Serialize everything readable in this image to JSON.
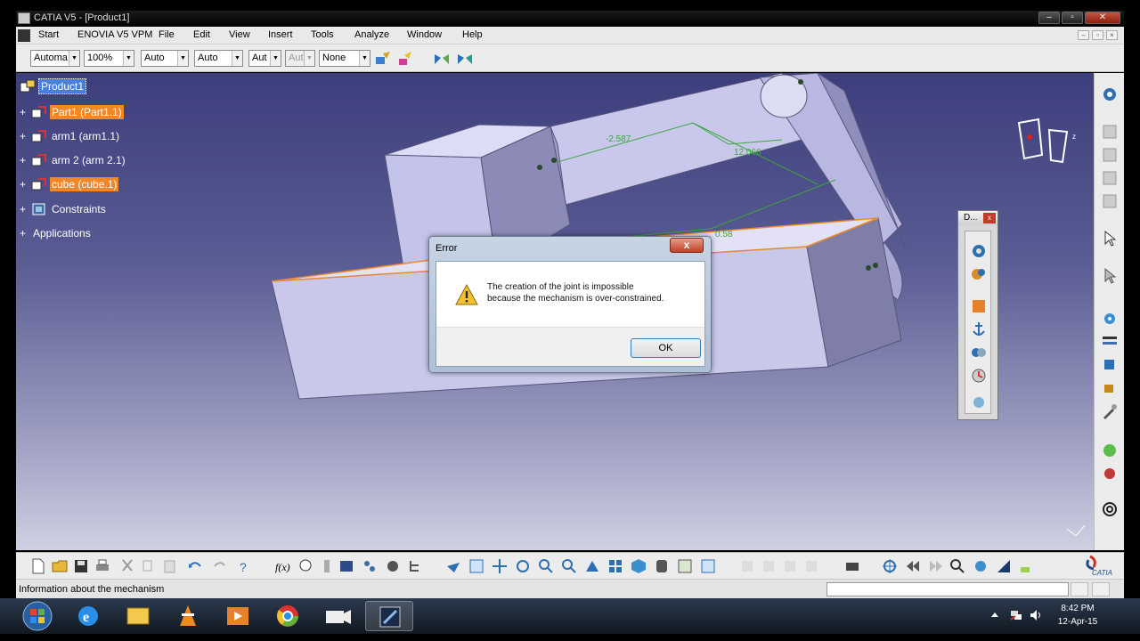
{
  "window": {
    "title": "CATIA V5 - [Product1]",
    "controls": {
      "minimize": "–",
      "maximize": "▫",
      "close": "✕"
    }
  },
  "menubar": {
    "items": [
      "Start",
      "ENOVIA V5 VPM",
      "File",
      "Edit",
      "View",
      "Insert",
      "Tools",
      "Analyze",
      "Window",
      "Help"
    ],
    "mdi_controls": {
      "minimize": "–",
      "restore": "▫",
      "close": "×"
    }
  },
  "toolbar": {
    "combos": [
      "Automa",
      "100%",
      "Auto",
      "Auto",
      "Aut",
      "Aut",
      "None"
    ]
  },
  "tree": {
    "root": "Product1",
    "items": [
      "Part1 (Part1.1)",
      "arm1 (arm1.1)",
      "arm 2 (arm 2.1)",
      "cube (cube.1)",
      "Constraints",
      "Applications"
    ]
  },
  "scene": {
    "dimensions": [
      "-2.587",
      "12.066",
      "0.58"
    ]
  },
  "dialog": {
    "title": "Error",
    "close": "x",
    "message_line1": "The creation of the joint is impossible",
    "message_line2": "because the mechanism is over-constrained.",
    "ok": "OK"
  },
  "palette": {
    "title": "D...",
    "close": "x"
  },
  "statusbar": {
    "text": "Information about the mechanism"
  },
  "brand": {
    "logo_text": "CATIA"
  },
  "clock": {
    "time": "8:42 PM",
    "date": "12-Apr-15"
  },
  "colors": {
    "highlight_orange": "#f0882a",
    "selection_blue": "#4a7fd6",
    "dimension_green": "#3ca63c"
  }
}
